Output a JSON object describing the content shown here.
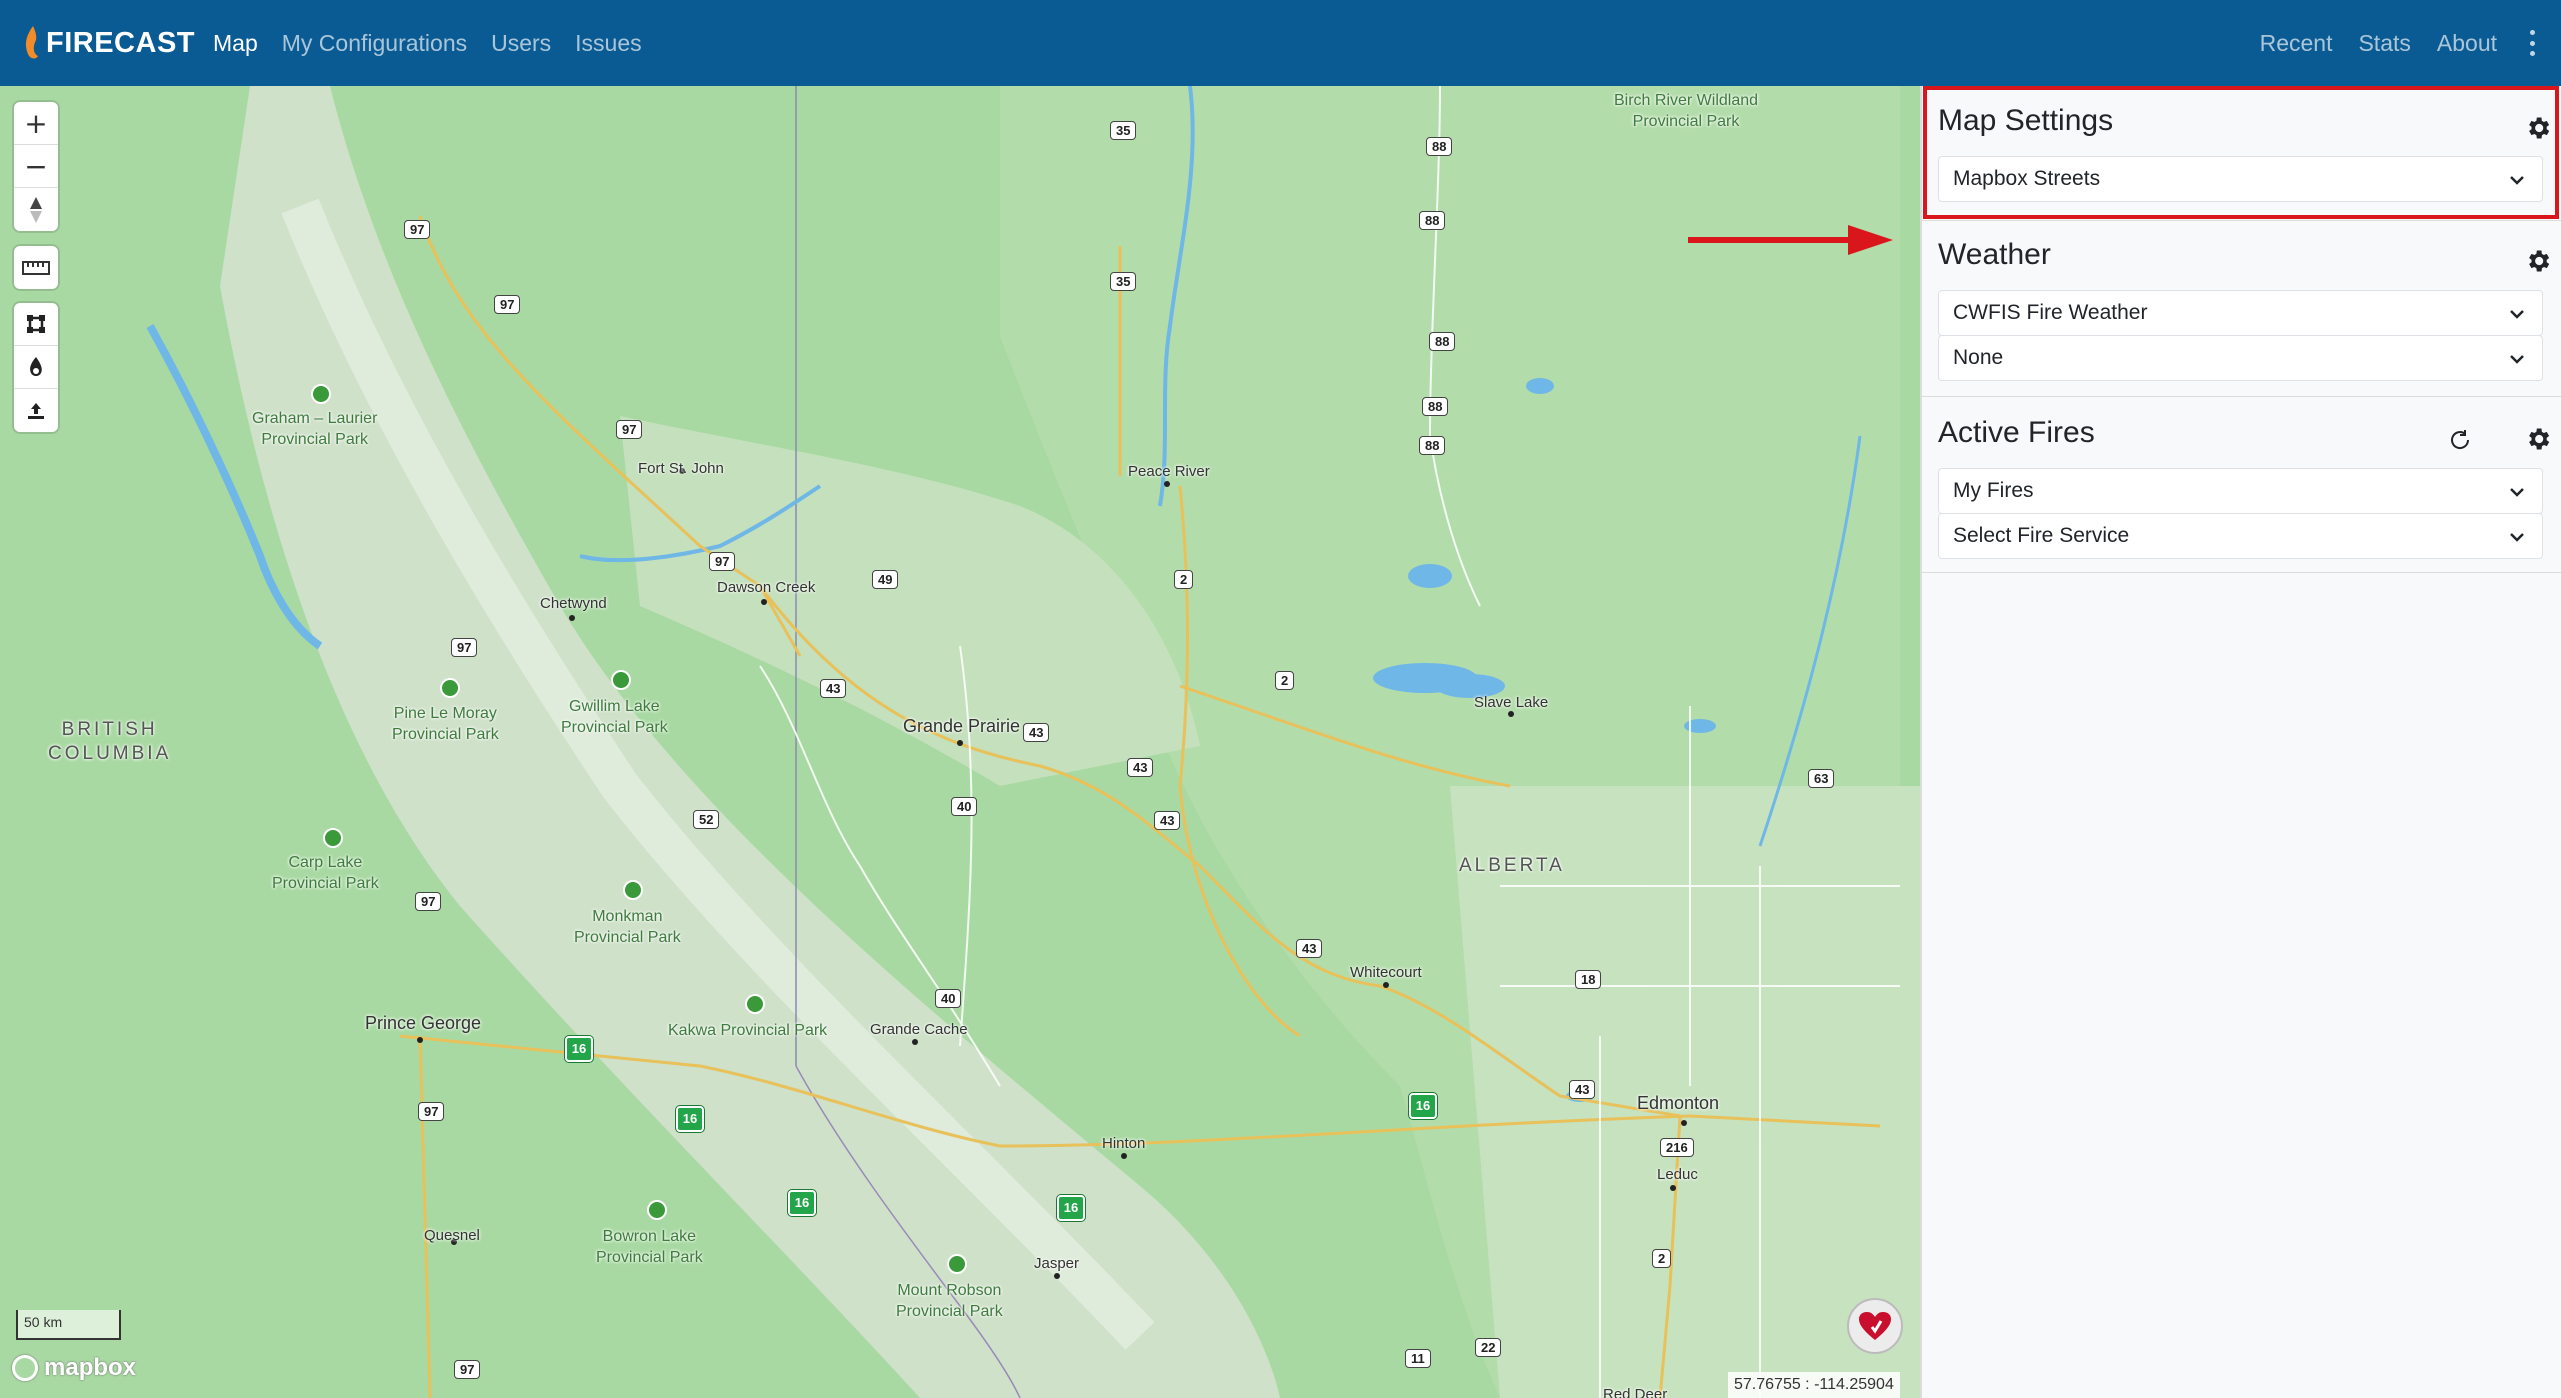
{
  "navbar": {
    "brand": "FIRECAST",
    "left_links": [
      "Map",
      "My Configurations",
      "Users",
      "Issues"
    ],
    "right_links": [
      "Recent",
      "Stats",
      "About"
    ]
  },
  "map": {
    "controls": {
      "zoom_in": "+",
      "zoom_out": "−"
    },
    "places": {
      "fort_st_john": "Fort St. John",
      "dawson_creek": "Dawson Creek",
      "chetwynd": "Chetwynd",
      "grande_prairie": "Grande Prairie",
      "peace_river": "Peace River",
      "slave_lake": "Slave Lake",
      "whitecourt": "Whitecourt",
      "edmonton": "Edmonton",
      "leduc": "Leduc",
      "hinton": "Hinton",
      "jasper": "Jasper",
      "grande_cache": "Grande Cache",
      "prince_george": "Prince George",
      "quesnel": "Quesnel",
      "red_deer": "Red Deer"
    },
    "parks": {
      "graham_laurier": "Graham – Laurier\nProvincial Park",
      "pine_le_moray": "Pine Le Moray\nProvincial Park",
      "gwillim_lake": "Gwillim Lake\nProvincial Park",
      "carp_lake": "Carp Lake\nProvincial Park",
      "monkman": "Monkman\nProvincial Park",
      "kakwa": "Kakwa Provincial Park",
      "bowron_lake": "Bowron Lake\nProvincial Park",
      "mount_robson": "Mount Robson\nProvincial Park",
      "birch_river": "Birch River Wildland\nProvincial Park"
    },
    "regions": {
      "bc": "BRITISH\nCOLUMBIA",
      "alberta": "ALBERTA"
    },
    "highways": [
      "97",
      "97",
      "97",
      "97",
      "97",
      "97",
      "97",
      "97",
      "35",
      "35",
      "88",
      "88",
      "88",
      "88",
      "88",
      "49",
      "43",
      "43",
      "43",
      "43",
      "43",
      "43",
      "2",
      "2",
      "2",
      "52",
      "40",
      "40",
      "18",
      "63",
      "216",
      "11",
      "22"
    ],
    "yellowhead": "16",
    "scale_label": "50 km",
    "attribution": "mapbox",
    "coordinates": "57.76755 : -114.25904"
  },
  "sidebar": {
    "map_settings": {
      "title": "Map Settings",
      "basemap": "Mapbox Streets"
    },
    "weather": {
      "title": "Weather",
      "layer": "CWFIS Fire Weather",
      "secondary": "None"
    },
    "active_fires": {
      "title": "Active Fires",
      "fires": "My Fires",
      "service": "Select Fire Service"
    }
  },
  "colors": {
    "navbar": "#0a5b93",
    "map_green": "#a9d9a3",
    "highlight": "#d9161b"
  }
}
